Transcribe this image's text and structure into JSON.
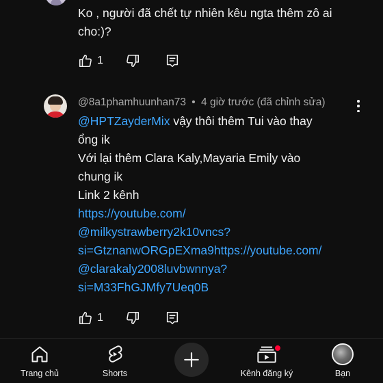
{
  "previous_comment": {
    "text": "Ko , người đã chết tự nhiên kêu ngta thêm zô ai cho:)?",
    "like_count": "1"
  },
  "comment": {
    "author": "@8a1phamhuunhan73",
    "separator": "•",
    "time": "4 giờ trước (đã chỉnh sửa)",
    "lines": [
      {
        "text": "vậy thôi thêm Tui vào thay",
        "mention": "@HPTZayderMix"
      },
      {
        "text": "ổng ik"
      },
      {
        "text": "Với lại thêm Clara Kaly,Mayaria Emily vào"
      },
      {
        "text": "chung ik"
      },
      {
        "text": "Link 2 kênh"
      },
      {
        "link": "https://youtube.com/"
      },
      {
        "link": "@milkystrawberry2k10vncs?"
      },
      {
        "link": "si=GtznanwORGpEXma9https://youtube.com/"
      },
      {
        "link": "@clarakaly2008luvbwnnya?"
      },
      {
        "link": "si=M33FhGJMfy7Ueq0B"
      }
    ],
    "like_count": "1"
  },
  "bottom_nav": {
    "home": "Trang chủ",
    "shorts": "Shorts",
    "subscriptions": "Kênh đăng ký",
    "you": "Bạn"
  },
  "colors": {
    "background": "#0f0f0f",
    "link": "#3ea6ff",
    "secondary_text": "#aaaaaa",
    "notification": "#ff0033"
  }
}
